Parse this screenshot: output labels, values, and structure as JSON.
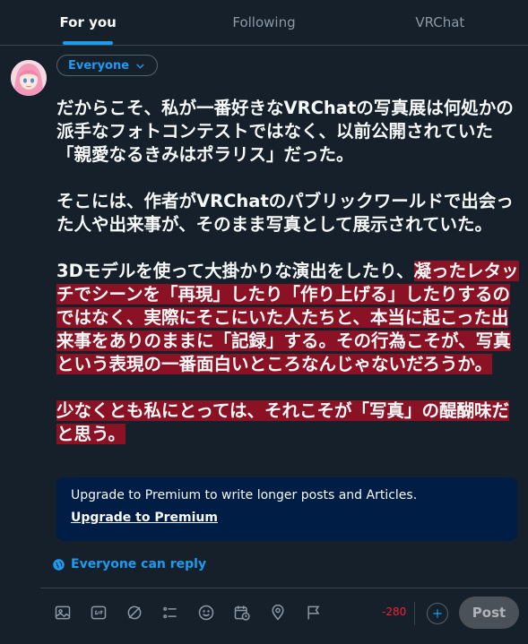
{
  "tabs": [
    {
      "label": "For you",
      "active": true
    },
    {
      "label": "Following",
      "active": false
    },
    {
      "label": "VRChat",
      "active": false
    }
  ],
  "composer": {
    "audience_label": "Everyone",
    "paragraphs": [
      {
        "normal": "だからこそ、私が一番好きなVRChatの写真展は何処かの派手なフォトコンテストではなく、以前公開されていた「親愛なるきみはポラリス」だった。",
        "highlight": ""
      },
      {
        "normal": "そこには、作者がVRChatのパブリックワールドで出会った人や出来事が、そのまま写真として展示されていた。",
        "highlight": ""
      },
      {
        "normal": "3Dモデルを使って大掛かりな演出をしたり、",
        "highlight": "凝ったレタッチでシーンを「再現」したり「作り上げる」したりするのではなく、実際にそこにいた人たちと、本当に起こった出来事をありのままに「記録」する。その行為こそが、写真という表現の一番面白いところなんじゃないだろうか。"
      },
      {
        "normal": "",
        "highlight": "少なくとも私にとっては、それこそが「写真」の醍醐味だと思う。"
      }
    ],
    "upsell": {
      "message": "Upgrade to Premium to write longer posts and Articles.",
      "link": "Upgrade to Premium"
    },
    "reply_setting": "Everyone can reply",
    "char_counter": "-280",
    "post_label": "Post"
  },
  "toolbar_icons": [
    "image-icon",
    "gif-icon",
    "grok-icon",
    "poll-icon",
    "emoji-icon",
    "schedule-icon",
    "location-icon",
    "flag-icon"
  ],
  "colors": {
    "background": "#15202b",
    "accent": "#1d9bf0",
    "highlight": "#8b1125",
    "upsell_bg": "#001d45",
    "counter": "#f4212e"
  }
}
